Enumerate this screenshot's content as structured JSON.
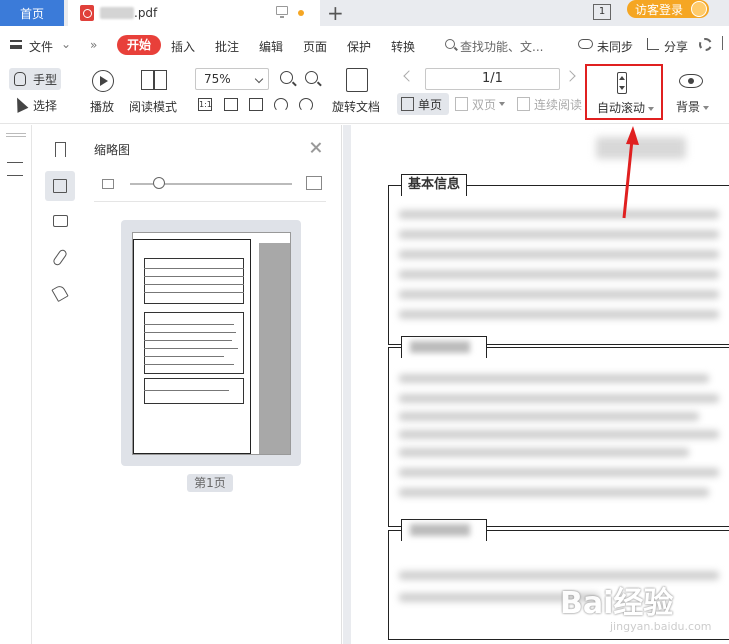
{
  "tabbar": {
    "home_label": "首页",
    "doc_tab_title": ".pdf",
    "page_count_badge": "1",
    "login_label": "访客登录"
  },
  "menu": {
    "file_label": "文件",
    "more_label": "»",
    "start_label": "开始",
    "insert_label": "插入",
    "annotate_label": "批注",
    "edit_label": "编辑",
    "page_label": "页面",
    "protect_label": "保护",
    "convert_label": "转换",
    "search_placeholder": "查找功能、文...",
    "sync_label": "未同步",
    "share_label": "分享"
  },
  "toolbar": {
    "hand_label": "手型",
    "select_label": "选择",
    "play_label": "播放",
    "read_mode_label": "阅读模式",
    "zoom_value": "75%",
    "rotate_label": "旋转文档",
    "page_indicator": "1/1",
    "single_page_label": "单页",
    "double_page_label": "双页",
    "continuous_label": "连续阅读",
    "auto_scroll_label": "自动滚动",
    "background_label": "背景"
  },
  "thumbnail_panel": {
    "title": "缩略图",
    "page_label": "第1页"
  },
  "document": {
    "section1_title": "基本信息"
  },
  "watermark": {
    "text": "Bai经验",
    "sub": "jingyan.baidu.com"
  },
  "colors": {
    "accent_blue": "#3b7bd9",
    "start_red": "#e8403a",
    "highlight_red": "#e02020",
    "login_orange": "#f5a623"
  }
}
